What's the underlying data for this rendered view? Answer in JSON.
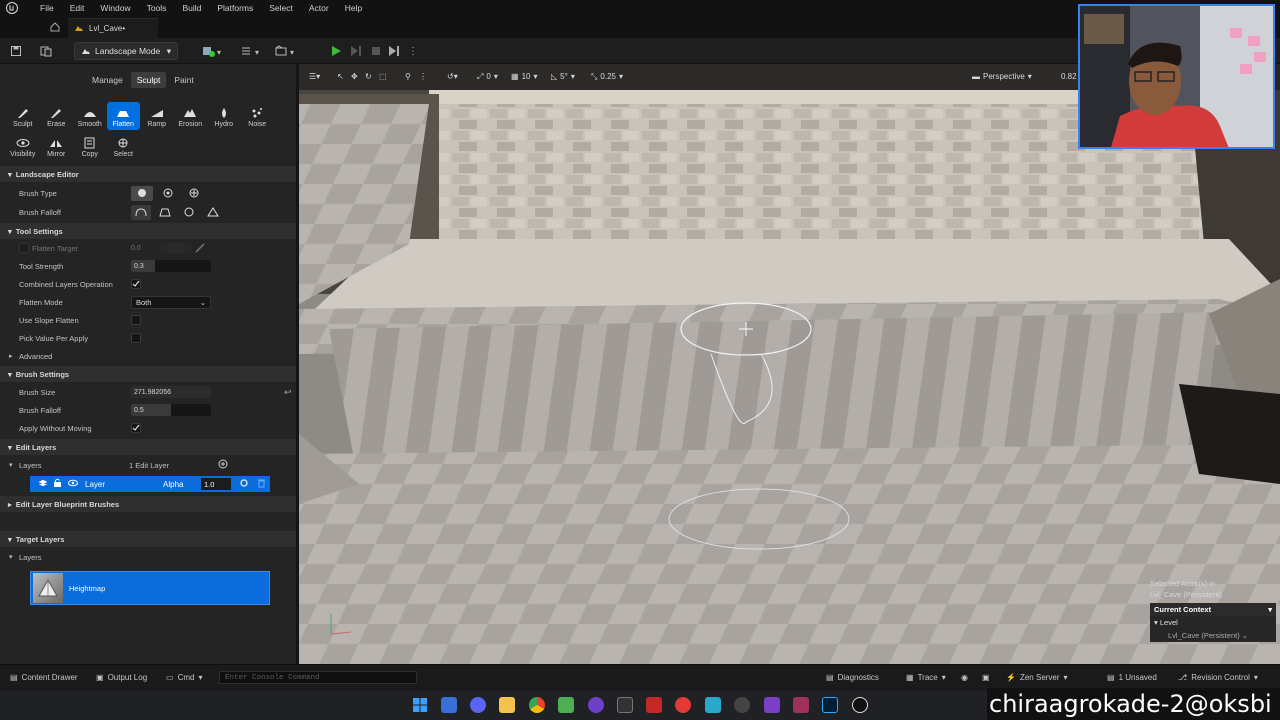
{
  "menu": {
    "items": [
      "File",
      "Edit",
      "Window",
      "Tools",
      "Build",
      "Platforms",
      "Select",
      "Actor",
      "Help"
    ]
  },
  "level_tab": {
    "label": "Lvl_Cave•"
  },
  "toolbar": {
    "mode_label": "Landscape Mode"
  },
  "mode_tabs": [
    "Manage",
    "Sculpt",
    "Paint"
  ],
  "tools": [
    "Sculpt",
    "Erase",
    "Smooth",
    "Flatten",
    "Ramp",
    "Erosion",
    "Hydro",
    "Noise",
    "Visibility",
    "Mirror",
    "Copy",
    "Select"
  ],
  "landscape_editor": {
    "header": "Landscape Editor",
    "brush_type_label": "Brush Type",
    "brush_falloff_label": "Brush Falloff"
  },
  "tool_settings": {
    "header": "Tool Settings",
    "flatten_target_label": "Flatten Target",
    "flatten_target_value": "0.0",
    "tool_strength_label": "Tool Strength",
    "tool_strength_value": "0.3",
    "tool_strength_fraction": 0.3,
    "combined_layers_label": "Combined Layers Operation",
    "combined_layers_checked": true,
    "flatten_mode_label": "Flatten Mode",
    "flatten_mode_value": "Both",
    "use_slope_label": "Use Slope Flatten",
    "pick_value_label": "Pick Value Per Apply",
    "advanced_label": "Advanced"
  },
  "brush_settings": {
    "header": "Brush Settings",
    "size_label": "Brush Size",
    "size_value": "271.982056",
    "falloff_label": "Brush Falloff",
    "falloff_value": "0.5",
    "falloff_fraction": 0.5,
    "apply_label": "Apply Without Moving",
    "apply_checked": true
  },
  "edit_layers": {
    "header": "Edit Layers",
    "layers_label": "Layers",
    "count_label": "1 Edit Layer",
    "layer_name": "Layer",
    "alpha_label": "Alpha",
    "alpha_value": "1.0"
  },
  "blueprint_brushes": {
    "header": "Edit Layer Blueprint Brushes"
  },
  "target_layers": {
    "header": "Target Layers",
    "layers_label": "Layers",
    "heightmap_label": "Heightmap"
  },
  "viewport": {
    "translate_snap": "0",
    "grid_snap": "10",
    "rotation_snap": "5°",
    "scale_snap": "0.25",
    "view_mode": "Perspective",
    "fov_partial": "0.82"
  },
  "context_popup": {
    "selected_line1": "Selected Actor(s) in",
    "selected_line2": "Lvl_Cave (Persistent)",
    "current_context": "Current Context",
    "level": "Level",
    "level_value": "Lvl_Cave (Persistent)"
  },
  "statusbar": {
    "content_drawer": "Content Drawer",
    "output_log": "Output Log",
    "cmd": "Cmd",
    "console_placeholder": "Enter Console Command",
    "diagnostics": "Diagnostics",
    "trace": "Trace",
    "zen_server": "Zen Server",
    "unsaved": "1 Unsaved",
    "revision_control": "Revision Control"
  },
  "watermark": "chiraagrokade-2@oksbi",
  "colors": {
    "accent": "#0a6ddb",
    "play_green": "#3dbb3d",
    "panel_bg": "#242424"
  }
}
